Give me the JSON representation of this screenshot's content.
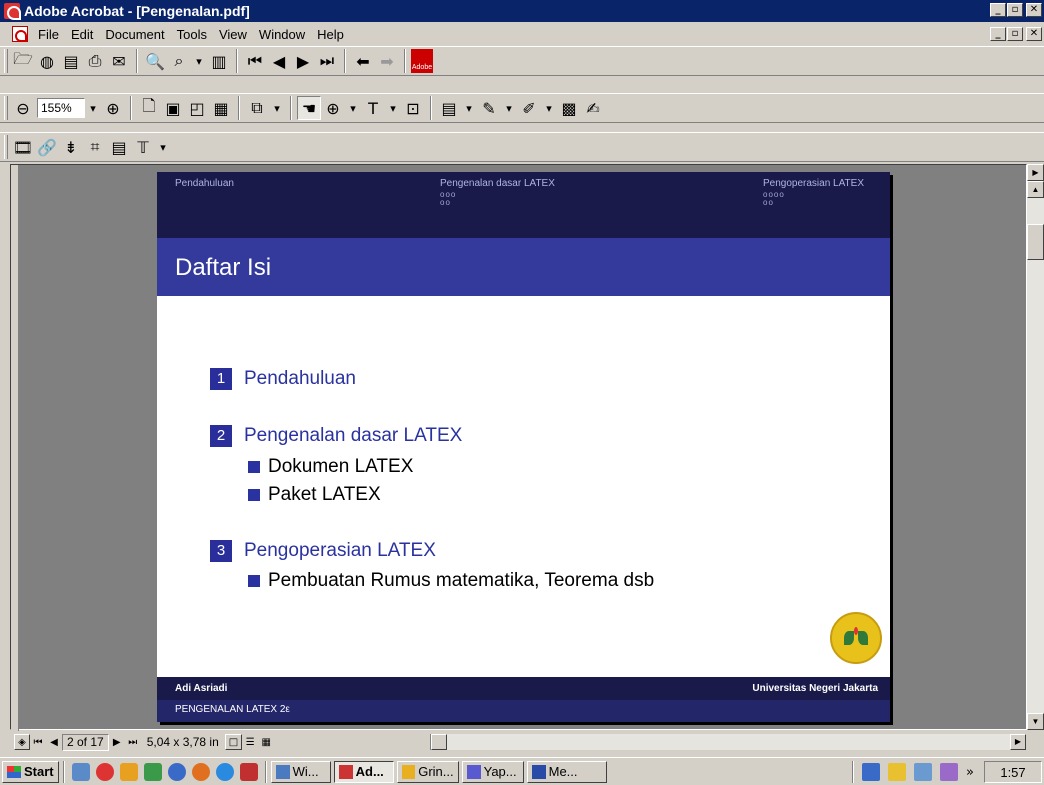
{
  "window": {
    "title": "Adobe Acrobat - [Pengenalan.pdf]"
  },
  "menu": {
    "items": [
      {
        "label": "File",
        "accel": "F"
      },
      {
        "label": "Edit",
        "accel": "E"
      },
      {
        "label": "Document",
        "accel": "D"
      },
      {
        "label": "Tools",
        "accel": "T"
      },
      {
        "label": "View",
        "accel": "V"
      },
      {
        "label": "Window",
        "accel": "W"
      },
      {
        "label": "Help",
        "accel": "H"
      }
    ]
  },
  "toolbar": {
    "zoom_value": "155%"
  },
  "slide": {
    "header_sections": [
      {
        "label": "Pendahuluan",
        "dots": ""
      },
      {
        "label": "Pengenalan dasar LATEX",
        "dots": "ooo\noo"
      },
      {
        "label": "Pengoperasian LATEX",
        "dots": "oooo\noo"
      }
    ],
    "title": "Daftar Isi",
    "toc": [
      {
        "num": "1",
        "label": "Pendahuluan",
        "subs": []
      },
      {
        "num": "2",
        "label": "Pengenalan dasar LATEX",
        "subs": [
          "Dokumen LATEX",
          "Paket LATEX"
        ]
      },
      {
        "num": "3",
        "label": "Pengoperasian LATEX",
        "subs": [
          "Pembuatan Rumus matematika, Teorema dsb"
        ]
      }
    ],
    "footer_author": "Adi Asriadi",
    "footer_institution": "Universitas Negeri Jakarta",
    "footer_short_title": "PENGENALAN LATEX 2ε"
  },
  "status": {
    "page_indicator": "2 of 17",
    "page_size": "5,04 x 3,78 in"
  },
  "taskbar": {
    "start_label": "Start",
    "tasks": [
      {
        "label": "Wi...",
        "active": false
      },
      {
        "label": "Ad...",
        "active": true
      },
      {
        "label": "Grin...",
        "active": false
      },
      {
        "label": "Yap...",
        "active": false
      },
      {
        "label": "Me...",
        "active": false
      }
    ],
    "clock": "1:57"
  },
  "colors": {
    "titlebar": "#0a246a",
    "slide_dark": "#191a4a",
    "slide_accent": "#333a9c"
  }
}
